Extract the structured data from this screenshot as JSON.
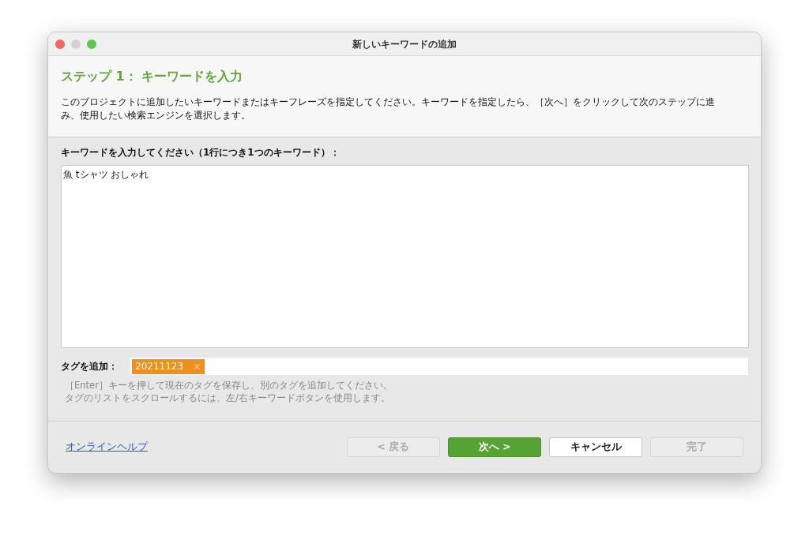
{
  "window": {
    "title": "新しいキーワードの追加"
  },
  "header": {
    "title": "ステップ 1： キーワードを入力",
    "description": "このプロジェクトに追加したいキーワードまたはキーフレーズを指定してください。キーワードを指定したら、［次へ］をクリックして次のステップに進み、使用したい検索エンジンを選択します。"
  },
  "keywords": {
    "label": "キーワードを入力してください（1行につき1つのキーワード）：",
    "value": "魚 tシャツ おしゃれ"
  },
  "tags": {
    "label": "タグを追加：",
    "items": [
      {
        "text": "20211123"
      }
    ],
    "hint": [
      "［Enter］キーを押して現在のタグを保存し、別のタグを追加してください。",
      "タグのリストをスクロールするには、左/右キーワードボタンを使用します。"
    ]
  },
  "footer": {
    "help_link": "オンラインヘルプ",
    "buttons": [
      {
        "label": "< 戻る",
        "kind": "default",
        "disabled": true
      },
      {
        "label": "次へ >",
        "kind": "primary",
        "disabled": false
      },
      {
        "label": "キャンセル",
        "kind": "default",
        "disabled": false
      },
      {
        "label": "完了",
        "kind": "default",
        "disabled": true
      }
    ]
  }
}
